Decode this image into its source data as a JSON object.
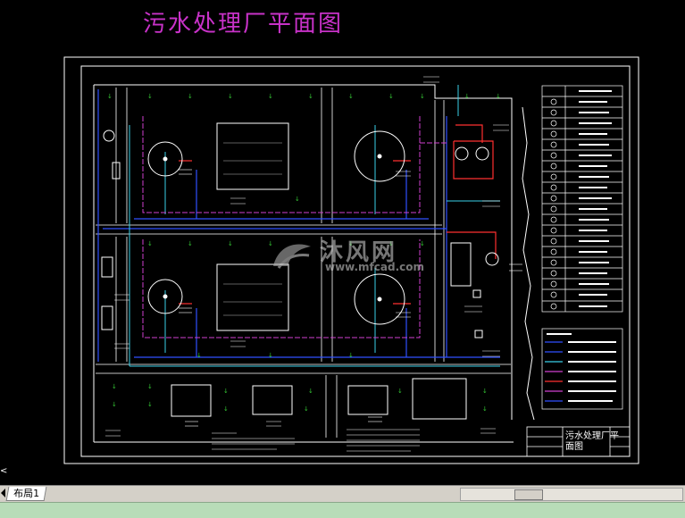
{
  "title": "污水处理厂平面图",
  "layout_tab": "布局1",
  "watermark": {
    "brand": "沐风网",
    "url": "www.mfcad.com"
  },
  "title_block": {
    "drawing_name_line1": "污水处理厂平",
    "drawing_name_line2": "面图"
  },
  "colors": {
    "title": "#c832c8",
    "frame": "#ffffff",
    "building": "#ffffff",
    "pipe_blue": "#3050ff",
    "pipe_cyan": "#3ad0e8",
    "pipe_magenta": "#d040d0",
    "pipe_red": "#ff3030",
    "tree_green": "#35c835"
  }
}
